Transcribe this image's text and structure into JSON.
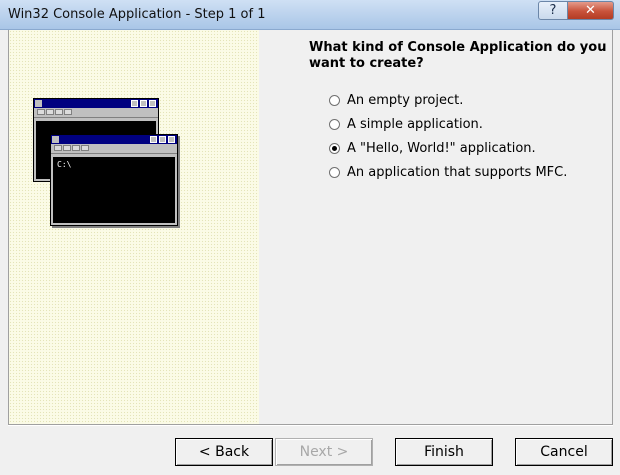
{
  "window": {
    "title": "Win32 Console Application - Step 1 of 1",
    "help_symbol": "?",
    "close_symbol": "✕"
  },
  "illustration": {
    "prompt_text": "C:\\"
  },
  "wizard": {
    "question": "What kind of Console Application do you want to create?",
    "options": [
      {
        "label": "An empty project.",
        "selected": false
      },
      {
        "label": "A simple application.",
        "selected": false
      },
      {
        "label": "A \"Hello, World!\" application.",
        "selected": true
      },
      {
        "label": "An application that supports MFC.",
        "selected": false
      }
    ]
  },
  "buttons": {
    "back": "< Back",
    "next": "Next >",
    "finish": "Finish",
    "cancel": "Cancel"
  }
}
